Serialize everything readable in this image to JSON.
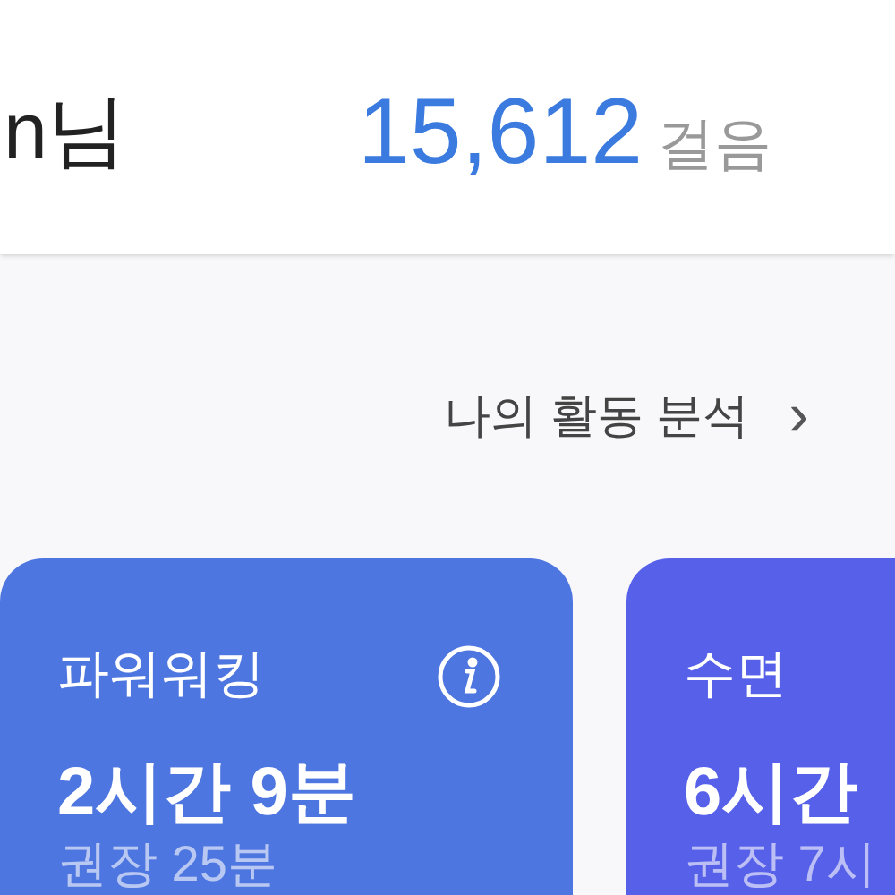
{
  "greeting": {
    "name": "n님"
  },
  "steps": {
    "count": "15,612",
    "unit": "걸음"
  },
  "analysis_link": {
    "label": "나의 활동 분석",
    "arrow": "›"
  },
  "cards": [
    {
      "title": "파워워킹",
      "info": true,
      "value": "2시간 9분",
      "recommended": "권장 25분",
      "color": "#4e76e0"
    },
    {
      "title": "수면",
      "value": "6시간",
      "recommended": "권장 7시",
      "color": "#5660e8"
    }
  ]
}
